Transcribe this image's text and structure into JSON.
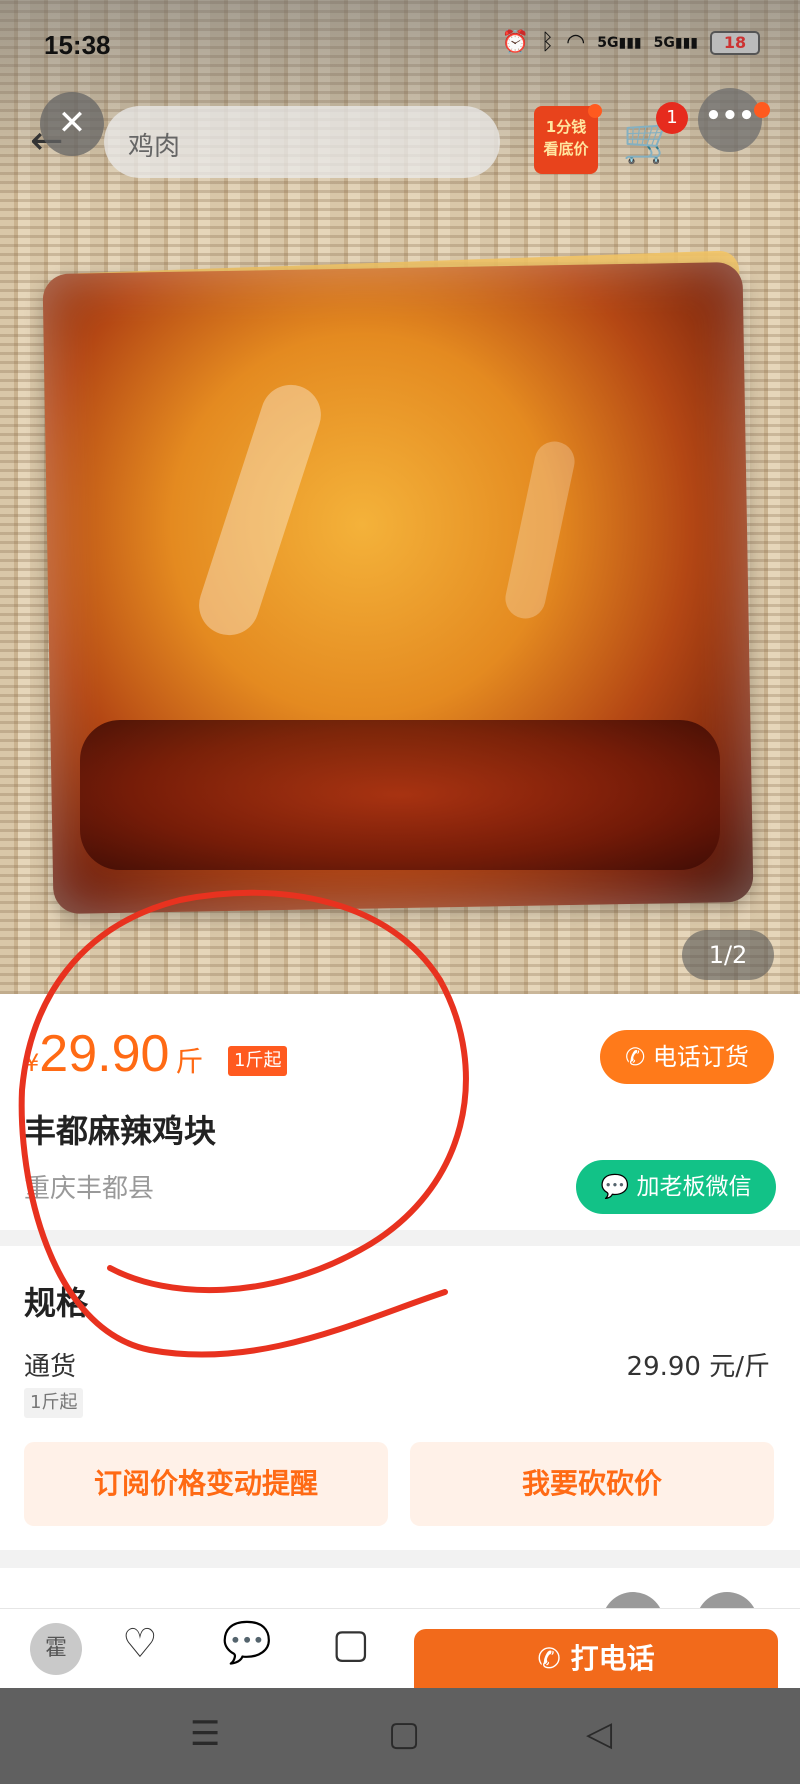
{
  "status_bar": {
    "time": "15:38",
    "network_1": "5G",
    "network_2": "5G",
    "battery": "18"
  },
  "nav": {
    "search_text": "鸡肉",
    "promo_line1": "1分钱",
    "promo_line2": "看底价",
    "cart_count": "1"
  },
  "gallery": {
    "page_indicator": "1/2"
  },
  "product": {
    "currency": "¥",
    "price": "29.90",
    "unit": "斤",
    "min_order": "1斤起",
    "call_order_label": "电话订货",
    "title": "丰都麻辣鸡块",
    "location": "重庆丰都县",
    "wechat_label": "加老板微信"
  },
  "spec": {
    "heading": "规格",
    "name": "通货",
    "price": "29.90 元/斤",
    "min_order": "1斤起",
    "subscribe_label": "订阅价格变动提醒",
    "bargain_label": "我要砍砍价"
  },
  "bottom_bar": {
    "shop_avatar": "霍",
    "call_label": "打电话"
  },
  "colors": {
    "accent_orange": "#ff6a14",
    "wechat_green": "#12c287",
    "annotation_red": "#e8321f"
  },
  "icons": [
    "back-arrow-icon",
    "close-icon",
    "cart-icon",
    "more-icon",
    "phone-icon",
    "wechat-icon",
    "heart-plus-icon",
    "chat-icon",
    "download-icon",
    "share-icon",
    "menu-icon",
    "home-icon",
    "back-triangle-icon"
  ]
}
